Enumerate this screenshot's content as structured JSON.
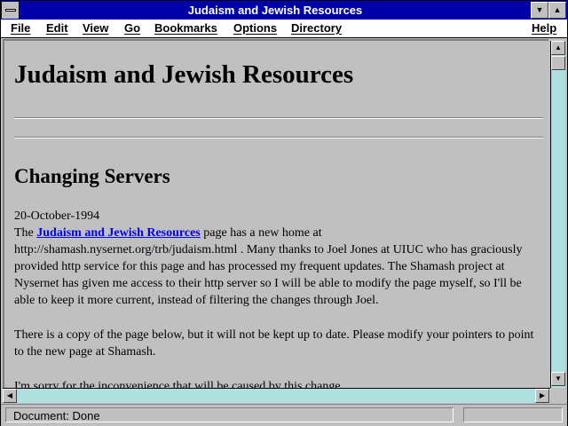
{
  "window": {
    "title": "Judaism and Jewish Resources"
  },
  "menu": {
    "items": [
      "File",
      "Edit",
      "View",
      "Go",
      "Bookmarks",
      "Options",
      "Directory"
    ],
    "help": "Help"
  },
  "page": {
    "heading": "Judaism and Jewish Resources",
    "section_heading": "Changing Servers",
    "date": "20-October-1994",
    "p1_prefix": "The ",
    "p1_link": "Judaism and Jewish Resources",
    "p1_rest": " page has a new home at http://shamash.nysernet.org/trb/judaism.html . Many thanks to Joel Jones at UIUC who has graciously provided http service for this page and has processed my frequent updates. The Shamash project at Nysernet has given me access to their http server so I will be able to modify the page myself, so I'll be able to keep it more current, instead of filtering the changes through Joel.",
    "p2": "There is a copy of the page below, but it will not be kept up to date. Please modify your pointers to point to the new page at Shamash.",
    "p3": "I'm sorry for the inconvenience that will be caused by this change."
  },
  "status": {
    "text": "Document: Done",
    "progress": 0
  },
  "colors": {
    "titlebar": "#0000a8",
    "scrollbar_track": "#aee0e0",
    "link": "#0000ff",
    "window_bg": "#c0c0c0"
  },
  "icons": {
    "system_menu": "system-menu-icon",
    "minimize": "minimize-icon",
    "maximize": "maximize-icon",
    "scroll_up": "arrow-up-icon",
    "scroll_down": "arrow-down-icon",
    "scroll_left": "arrow-left-icon",
    "scroll_right": "arrow-right-icon"
  }
}
